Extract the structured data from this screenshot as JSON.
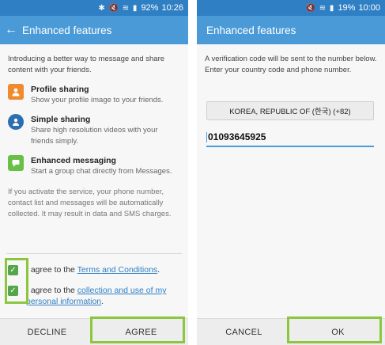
{
  "left": {
    "status": {
      "icons": "✱ 🔇 ≋ ▮",
      "battery": "92%",
      "time": "10:26"
    },
    "app_bar": {
      "title": "Enhanced features"
    },
    "intro": "Introducing a better way to message and share content with your friends.",
    "features": [
      {
        "title": "Profile sharing",
        "desc": "Show your profile image to your friends.",
        "icon": "profile-icon"
      },
      {
        "title": "Simple sharing",
        "desc": "Share high resolution videos with your friends simply.",
        "icon": "share-icon"
      },
      {
        "title": "Enhanced messaging",
        "desc": "Start a group chat directly from Messages.",
        "icon": "message-icon"
      }
    ],
    "note": "If you activate the service, your phone number, contact list and messages will be automatically collected. It may result in data and SMS charges.",
    "agree1": {
      "prefix": "I agree to the ",
      "link": "Terms and Conditions",
      "suffix": "."
    },
    "agree2": {
      "prefix": "I agree to the ",
      "link": "collection and use of my personal information",
      "suffix": "."
    },
    "buttons": {
      "decline": "DECLINE",
      "agree": "AGREE"
    }
  },
  "right": {
    "status": {
      "icons": "🔇 ≋ ▮",
      "battery": "19%",
      "time": "10:00"
    },
    "app_bar": {
      "title": "Enhanced features"
    },
    "instructions": "A verification code will be sent to the number below. Enter your country code and phone number.",
    "country": "KOREA, REPUBLIC OF (한국) (+82)",
    "phone_value": "01093645925",
    "buttons": {
      "cancel": "CANCEL",
      "ok": "OK"
    }
  },
  "colors": {
    "status_bar": "#2f7fc4",
    "app_bar": "#4a9ad7",
    "highlight": "#8cc63f",
    "checkbox": "#55a64a"
  }
}
